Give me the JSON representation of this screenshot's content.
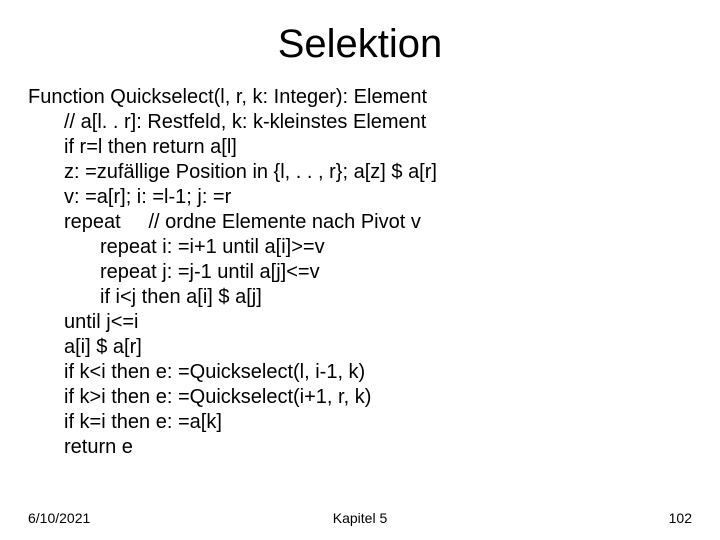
{
  "title": "Selektion",
  "lines": [
    {
      "indent": 0,
      "text": "Function Quickselect(l, r, k: Integer): Element"
    },
    {
      "indent": 1,
      "text": "// a[l. . r]: Restfeld, k: k-kleinstes Element"
    },
    {
      "indent": 1,
      "text": "if r=l then return a[l]"
    },
    {
      "indent": 1,
      "text": "z: =zufällige Position in {l, . . , r}; a[z] $ a[r]"
    },
    {
      "indent": 1,
      "text": "v: =a[r]; i: =l-1; j: =r"
    },
    {
      "indent": 1,
      "text": "repeat     // ordne Elemente nach Pivot v"
    },
    {
      "indent": 2,
      "text": "repeat i: =i+1 until a[i]>=v"
    },
    {
      "indent": 2,
      "text": "repeat j: =j-1 until a[j]<=v"
    },
    {
      "indent": 2,
      "text": "if i<j then a[i] $ a[j]"
    },
    {
      "indent": 1,
      "text": "until j<=i"
    },
    {
      "indent": 1,
      "text": "a[i] $ a[r]"
    },
    {
      "indent": 1,
      "text": "if k<i then e: =Quickselect(l, i-1, k)"
    },
    {
      "indent": 1,
      "text": "if k>i then e: =Quickselect(i+1, r, k)"
    },
    {
      "indent": 1,
      "text": "if k=i then e: =a[k]"
    },
    {
      "indent": 1,
      "text": "return e"
    }
  ],
  "footer": {
    "date": "6/10/2021",
    "chapter": "Kapitel 5",
    "page": "102"
  }
}
